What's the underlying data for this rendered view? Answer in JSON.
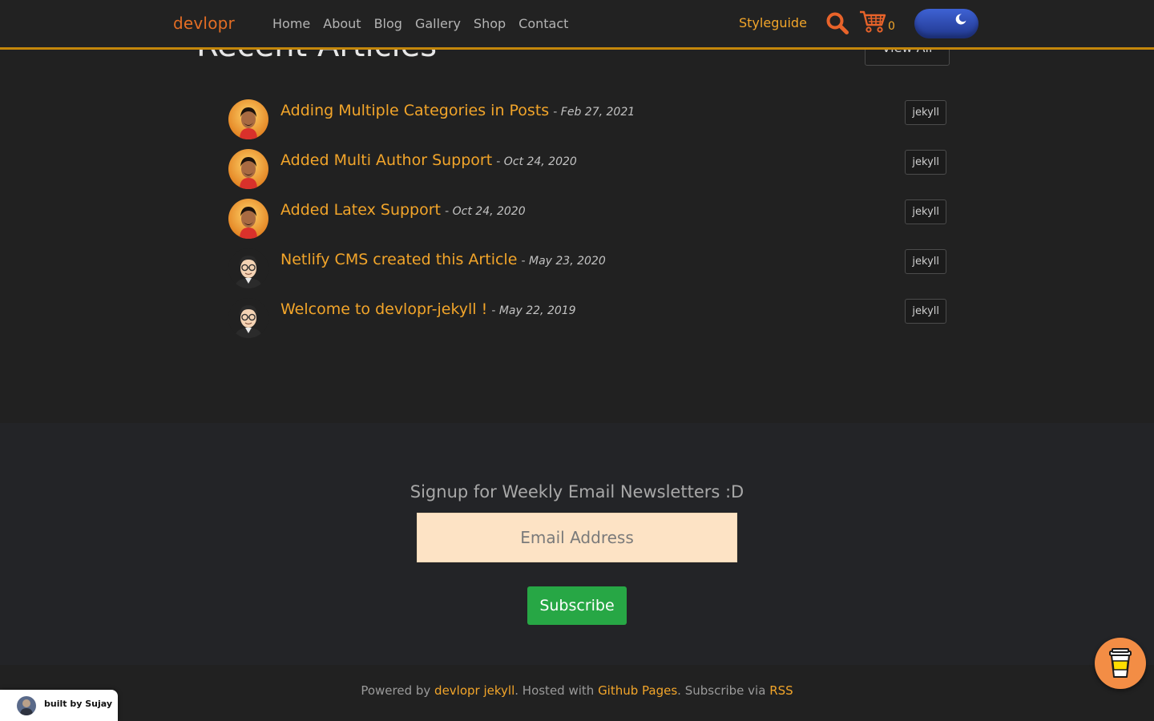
{
  "colors": {
    "background": "#212121",
    "accent_orange": "#f2a52a",
    "brand_orange": "#e36d24",
    "navbar_border": "#c4870b",
    "subscribe_green": "#27a745",
    "email_input_bg": "#fde3c5"
  },
  "navbar": {
    "brand": "devlopr",
    "links": [
      "Home",
      "About",
      "Blog",
      "Gallery",
      "Shop",
      "Contact"
    ],
    "styleguide": "Styleguide",
    "cart_count": "0",
    "icons": [
      "search-icon",
      "cart-icon",
      "moon-icon"
    ]
  },
  "recent": {
    "title": "Recent Articles",
    "view_all": "View All",
    "articles": [
      {
        "title": "Adding Multiple Categories in Posts",
        "date": "Feb 27, 2021",
        "tag": "jekyll",
        "avatar": "photo"
      },
      {
        "title": "Added Multi Author Support",
        "date": "Oct 24, 2020",
        "tag": "jekyll",
        "avatar": "photo"
      },
      {
        "title": "Added Latex Support",
        "date": "Oct 24, 2020",
        "tag": "jekyll",
        "avatar": "photo"
      },
      {
        "title": "Netlify CMS created this Article",
        "date": "May 23, 2020",
        "tag": "jekyll",
        "avatar": "cartoon"
      },
      {
        "title": "Welcome to devlopr-jekyll !",
        "date": "May 22, 2019",
        "tag": "jekyll",
        "avatar": "cartoon"
      }
    ]
  },
  "newsletter": {
    "heading": "Signup for Weekly Email Newsletters :D",
    "email_placeholder": "Email Address",
    "subscribe": "Subscribe"
  },
  "footer": {
    "powered_prefix": "Powered by ",
    "powered_link": "devlopr jekyll",
    "hosted_prefix": ". Hosted with ",
    "hosted_link": "Github Pages",
    "subscribe_prefix": ". Subscribe via ",
    "rss_link": "RSS"
  },
  "built_by": "built by Sujay",
  "coffee_icon": "coffee-cup-icon"
}
